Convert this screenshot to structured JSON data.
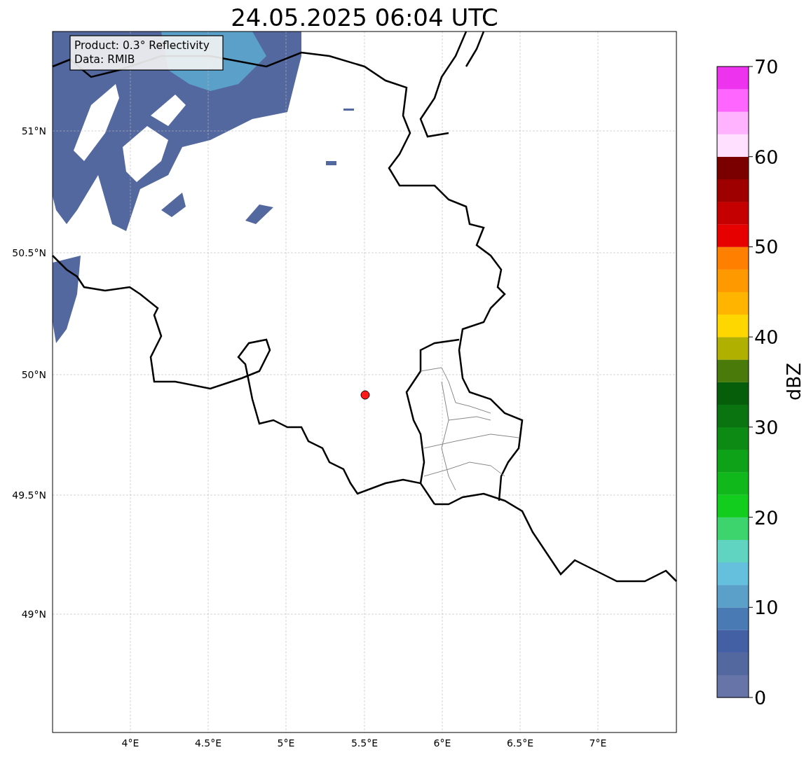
{
  "title": "24.05.2025 06:04 UTC",
  "map": {
    "legend": [
      "Product: 0.3° Reflectivity",
      "Data: RMIB"
    ],
    "x_tick_labels": [
      "4°E",
      "4.5°E",
      "5°E",
      "5.5°E",
      "6°E",
      "6.5°E",
      "7°E"
    ],
    "y_tick_labels": [
      "51°N",
      "50.5°N",
      "50°N",
      "49.5°N",
      "49°N"
    ]
  },
  "colorbar": {
    "label": "dBZ",
    "tick_labels": [
      "70",
      "60",
      "50",
      "40",
      "30",
      "20",
      "10",
      "0"
    ],
    "bins": [
      {
        "color": "#6674a8"
      },
      {
        "color": "#5468a0"
      },
      {
        "color": "#4460a4"
      },
      {
        "color": "#4a7ab4"
      },
      {
        "color": "#5aa0c8"
      },
      {
        "color": "#64c0dc"
      },
      {
        "color": "#60d4c0"
      },
      {
        "color": "#3dd46e"
      },
      {
        "color": "#12cc1e"
      },
      {
        "color": "#10b81c"
      },
      {
        "color": "#0ea218"
      },
      {
        "color": "#0c8a14"
      },
      {
        "color": "#0a7510"
      },
      {
        "color": "#065e0a"
      },
      {
        "color": "#4a7a0a"
      },
      {
        "color": "#b0b000"
      },
      {
        "color": "#ffd700"
      },
      {
        "color": "#ffb400"
      },
      {
        "color": "#ff9900"
      },
      {
        "color": "#ff7f00"
      },
      {
        "color": "#e60000"
      },
      {
        "color": "#c40000"
      },
      {
        "color": "#9e0000"
      },
      {
        "color": "#7a0000"
      },
      {
        "color": "#ffe0ff"
      },
      {
        "color": "#ffb3ff"
      },
      {
        "color": "#ff66ff"
      },
      {
        "color": "#ee33ee"
      }
    ]
  }
}
